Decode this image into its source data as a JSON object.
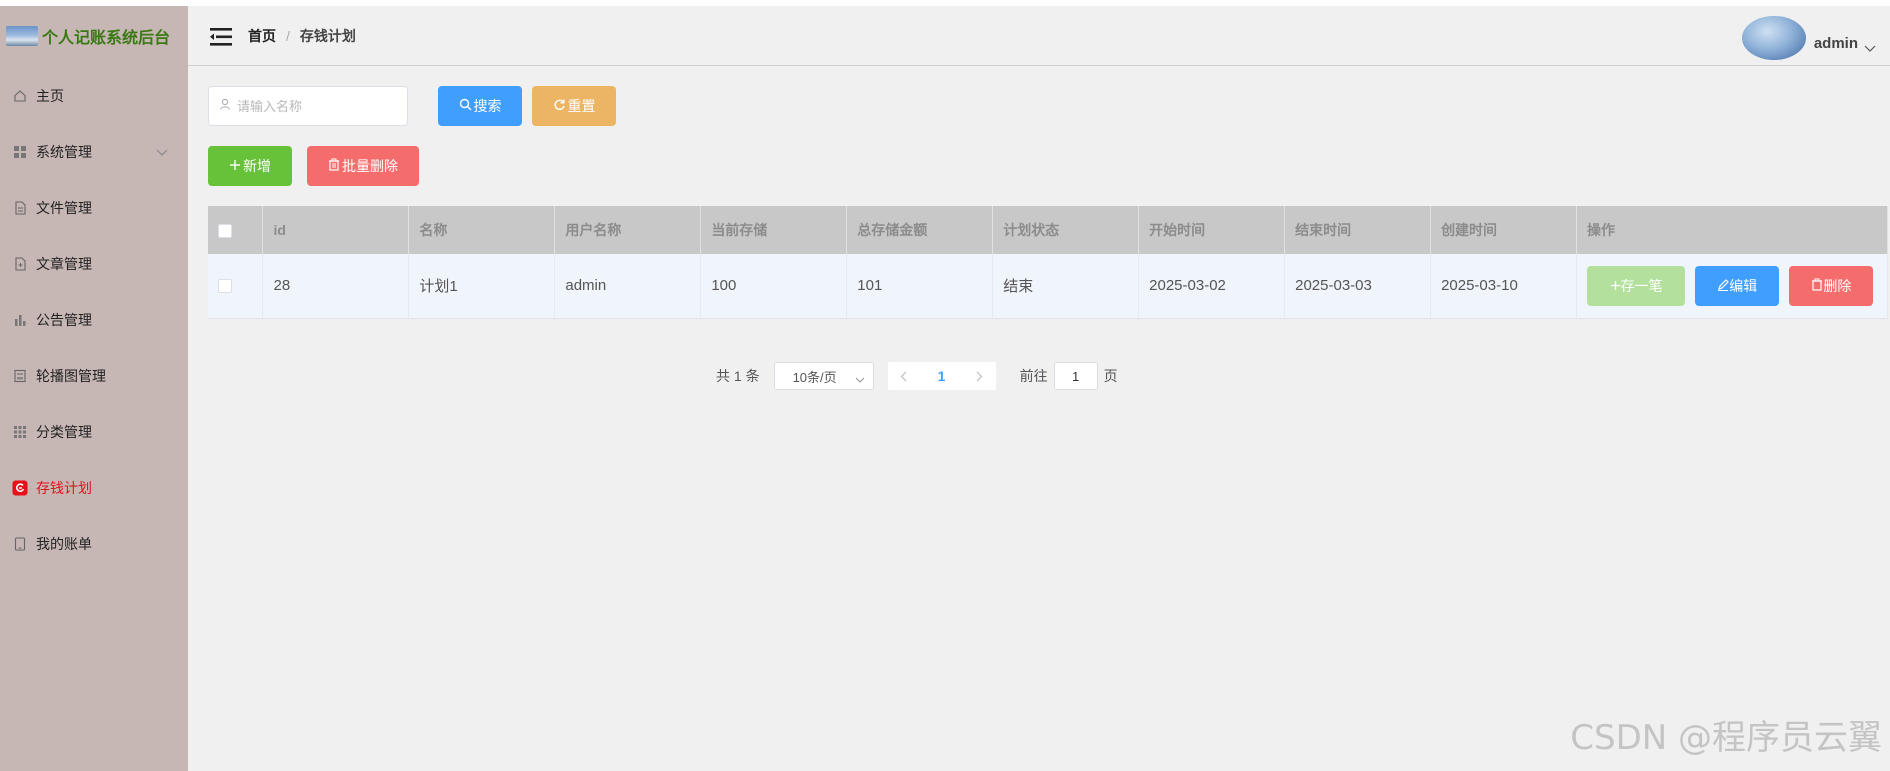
{
  "app": {
    "title": "个人记账系统后台",
    "accent": "#409eff",
    "active_color": "#e8101a"
  },
  "sidebar": {
    "items": [
      {
        "label": "主页",
        "icon": "home-icon"
      },
      {
        "label": "系统管理",
        "icon": "grid-icon"
      },
      {
        "label": "文件管理",
        "icon": "document-icon"
      },
      {
        "label": "文章管理",
        "icon": "article-icon"
      },
      {
        "label": "公告管理",
        "icon": "bar-chart-icon"
      },
      {
        "label": "轮播图管理",
        "icon": "picture-icon"
      },
      {
        "label": "分类管理",
        "icon": "apps-icon"
      },
      {
        "label": "存钱计划",
        "icon": "plan-icon"
      },
      {
        "label": "我的账单",
        "icon": "tablet-icon"
      }
    ],
    "active": "存钱计划"
  },
  "header": {
    "breadcrumb": {
      "home": "首页",
      "separator": "/",
      "current": "存钱计划"
    },
    "username": "admin"
  },
  "toolbar": {
    "search_placeholder": "请输入名称",
    "search_label": "搜索",
    "reset_label": "重置",
    "add_label": "新增",
    "batch_delete_label": "批量删除"
  },
  "table": {
    "columns": [
      "id",
      "名称",
      "用户名称",
      "当前存储",
      "总存储金额",
      "计划状态",
      "开始时间",
      "结束时间",
      "创建时间",
      "操作"
    ],
    "rows": [
      {
        "id": "28",
        "name": "计划1",
        "user": "admin",
        "current": "100",
        "total": "101",
        "status": "结束",
        "start": "2025-03-02",
        "end": "2025-03-03",
        "created": "2025-03-10",
        "actions": {
          "deposit": "存一笔",
          "edit": "编辑",
          "delete": "删除"
        }
      }
    ]
  },
  "pagination": {
    "total_text": "共 1 条",
    "page_size": "10条/页",
    "current_page": "1",
    "goto_label": "前往",
    "goto_value": "1",
    "page_suffix": "页"
  },
  "watermark": "CSDN @程序员云翼"
}
